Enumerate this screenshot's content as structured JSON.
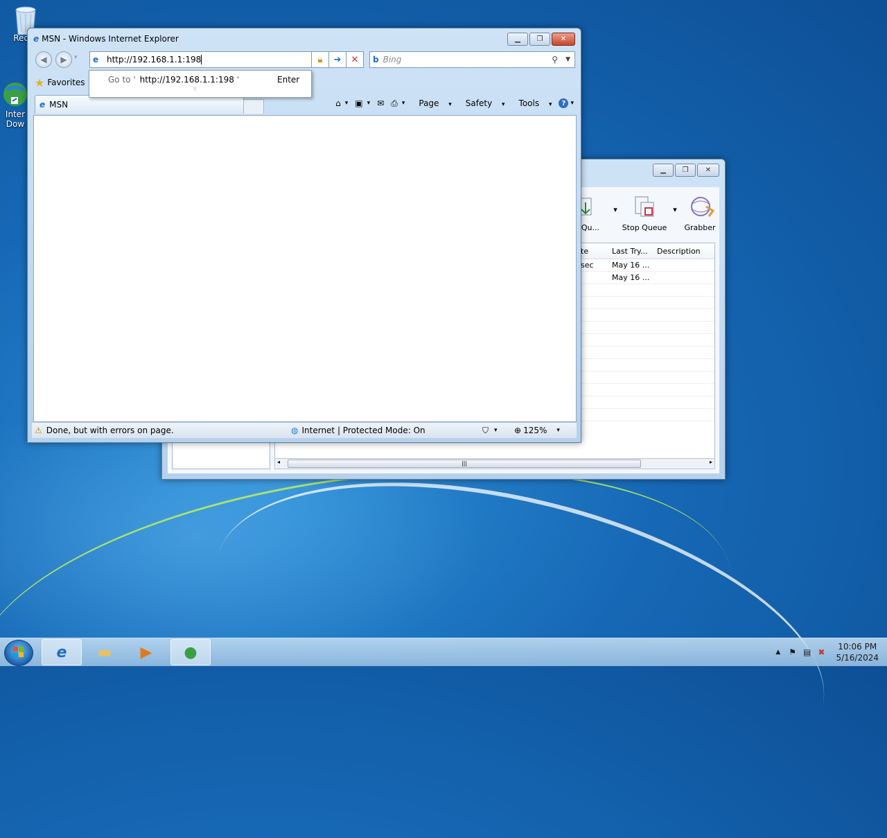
{
  "desktop": {
    "icons": [
      {
        "label": "Recyc"
      },
      {
        "label_line1": "Inter",
        "label_line2": "Dow"
      }
    ]
  },
  "idm_window": {
    "toolbar": [
      {
        "label": "t Qu..."
      },
      {
        "label": "Stop Queue"
      },
      {
        "label": "Grabber"
      }
    ],
    "columns": [
      "te",
      "Last Try...",
      "Description"
    ],
    "rows": [
      {
        "status": "sec",
        "last_try": "May 16 ..."
      },
      {
        "status": "",
        "last_try": "May 16 ..."
      }
    ]
  },
  "ie_window": {
    "title": "MSN - Windows Internet Explorer",
    "address": "http://192.168.1.1:198",
    "search_placeholder": "Bing",
    "favorites_label": "Favorites",
    "tab_label": "MSN",
    "commands": {
      "page": "Page",
      "safety": "Safety",
      "tools": "Tools"
    },
    "autocomplete": {
      "prefix": "Go to '",
      "url": "http://192.168.1.1:198",
      "suffix": "'",
      "action": "Enter"
    },
    "status": {
      "message": "Done, but with errors on page.",
      "zone": "Internet | Protected Mode: On",
      "zoom": "125%"
    }
  },
  "taskbar": {
    "clock_time": "10:06 PM",
    "clock_date": "5/16/2024"
  },
  "colors": {
    "accent": "#1e6fc5",
    "close": "#c6452c"
  }
}
